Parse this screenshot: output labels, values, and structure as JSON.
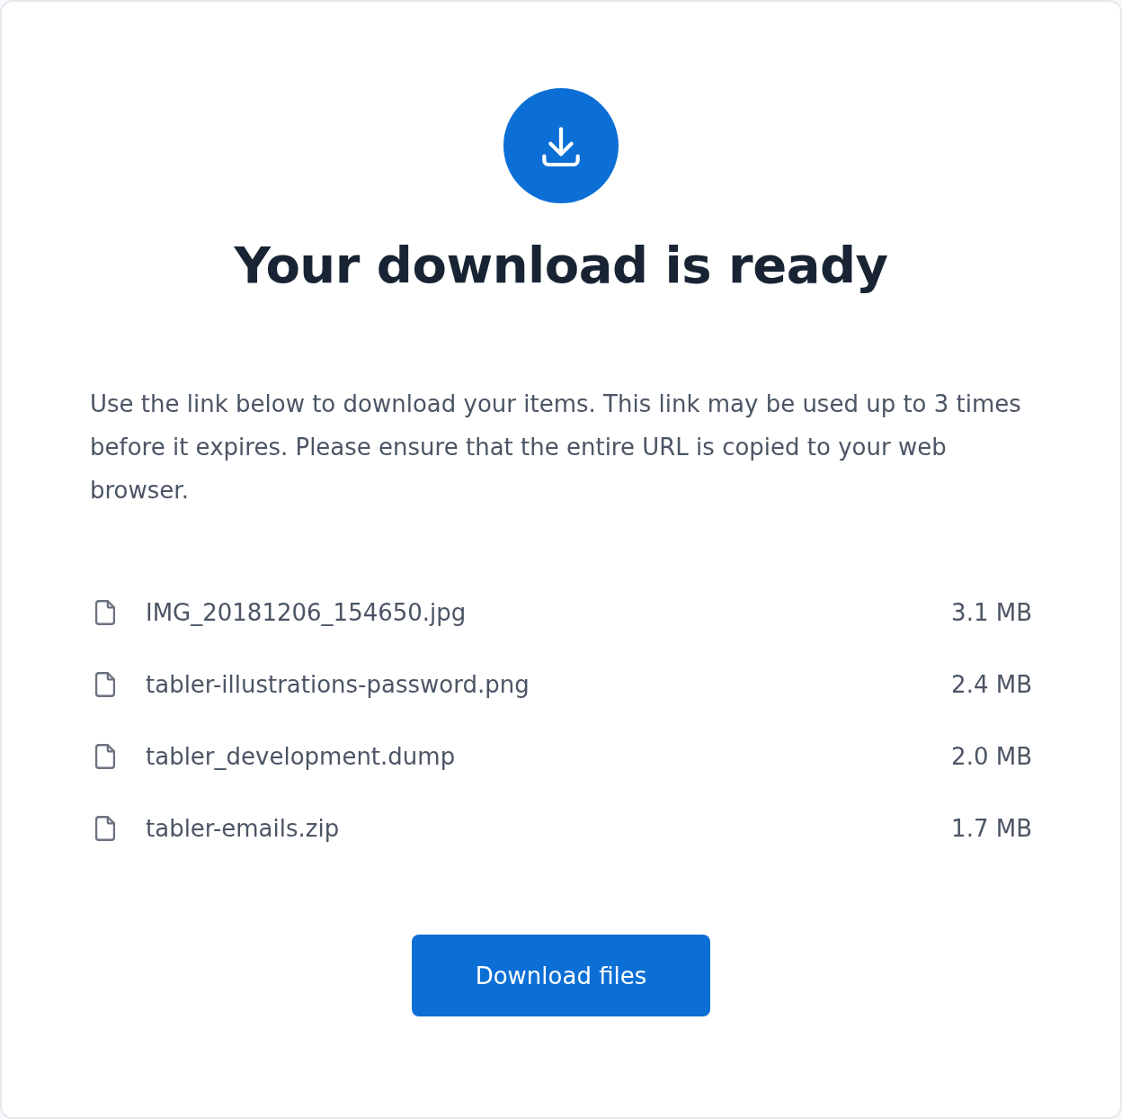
{
  "title": "Your download is ready",
  "description": "Use the link below to download your items. This link may be used up to 3 times before it expires. Please ensure that the entire URL is copied to your web browser.",
  "files": [
    {
      "name": "IMG_20181206_154650.jpg",
      "size": "3.1 MB"
    },
    {
      "name": "tabler-illustrations-password.png",
      "size": "2.4 MB"
    },
    {
      "name": "tabler_development.dump",
      "size": "2.0 MB"
    },
    {
      "name": "tabler-emails.zip",
      "size": "1.7 MB"
    }
  ],
  "button": "Download files"
}
